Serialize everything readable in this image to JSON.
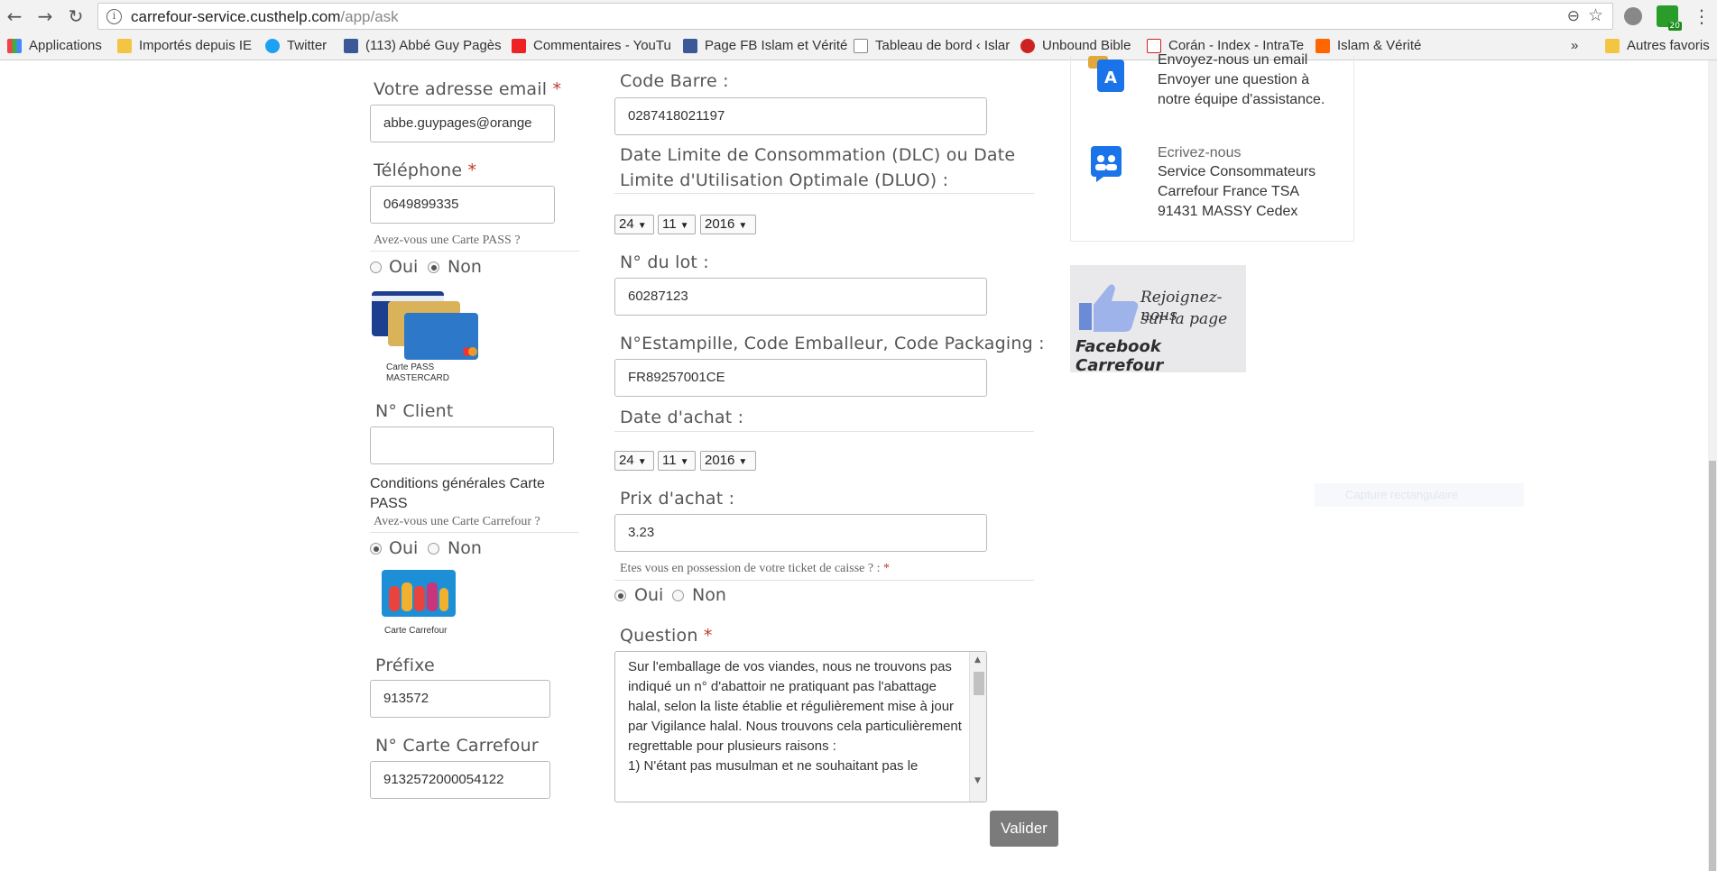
{
  "browser": {
    "url_host": "carrefour-service.custhelp.com",
    "url_path": "/app/ask",
    "bookmarks": [
      {
        "label": "Applications"
      },
      {
        "label": "Importés depuis IE"
      },
      {
        "label": "Twitter"
      },
      {
        "label": "(113) Abbé Guy Pagès"
      },
      {
        "label": "Commentaires - YouTu"
      },
      {
        "label": "Page FB Islam et Vérité"
      },
      {
        "label": "Tableau de bord ‹ Islar"
      },
      {
        "label": "Unbound Bible"
      },
      {
        "label": "Corán - Index - IntraTe"
      },
      {
        "label": "Islam & Vérité"
      },
      {
        "label": "»"
      },
      {
        "label": "Autres favoris"
      }
    ],
    "ext_badge": "20"
  },
  "left": {
    "email_label": "Votre adresse email",
    "email_value": "abbe.guypages@orange",
    "phone_label": "Téléphone",
    "phone_value": "0649899335",
    "pass_question": "Avez-vous une Carte PASS ?",
    "yes": "Oui",
    "no": "Non",
    "pass_card_caption": "Carte PASS MASTERCARD",
    "client_label": "N° Client",
    "client_value": "",
    "conditions": "Conditions générales Carte PASS",
    "carrefour_question": "Avez-vous une Carte Carrefour ?",
    "carrefour_card_caption": "Carte Carrefour",
    "prefix_label": "Préfixe",
    "prefix_value": "913572",
    "card_number_label": "N° Carte Carrefour",
    "card_number_value": "9132572000054122"
  },
  "middle": {
    "barcode_label": "Code Barre :",
    "barcode_value": "0287418021197",
    "dlc_label_line1": "Date Limite de Consommation (DLC) ou Date",
    "dlc_label_line2": "Limite d'Utilisation Optimale (DLUO) :",
    "dlc_day": "24",
    "dlc_month": "11",
    "dlc_year": "2016",
    "lot_label": "N° du lot :",
    "lot_value": "60287123",
    "stamp_label": "N°Estampille, Code Emballeur, Code Packaging :",
    "stamp_value": "FR89257001CE",
    "purchase_date_label": "Date d'achat :",
    "purchase_day": "24",
    "purchase_month": "11",
    "purchase_year": "2016",
    "price_label": "Prix d'achat :",
    "price_value": "3.23",
    "ticket_question": "Etes vous en possession de votre ticket de caisse ? :",
    "question_label": "Question",
    "question_text": "Sur l'emballage de vos viandes, nous ne trouvons pas indiqué un n° d'abattoir ne pratiquant pas l'abattage halal, selon la liste établie et régulièrement mise à jour par Vigilance halal. Nous trouvons cela particulièrement regrettable pour plusieurs raisons :\n1) N'étant pas musulman et ne souhaitant pas le",
    "submit": "Valider"
  },
  "right": {
    "email_title": "Envoyez-nous un email",
    "email_desc": "Envoyer une question à notre équipe d'assistance.",
    "write_title": "Ecrivez-nous",
    "address_line1": "Service Consommateurs",
    "address_line2": "Carrefour France TSA",
    "address_line3": "91431 MASSY Cedex",
    "fb_line1": "Rejoignez-nous",
    "fb_line2": "sur la page",
    "fb_line3": "Facebook Carrefour"
  },
  "overlay": {
    "capture_label": "Capture rectangulaire"
  },
  "colors": {
    "required": "#c0392b",
    "submit_bg": "#7b7b7b",
    "fb_blue": "#6b8bd6"
  }
}
